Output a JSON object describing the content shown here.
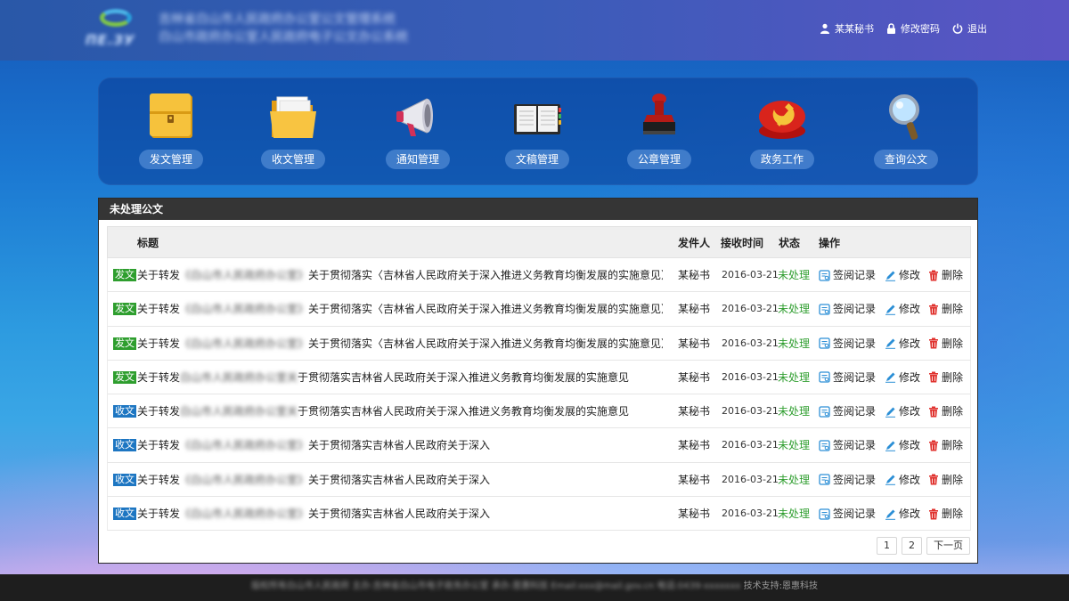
{
  "header": {
    "logo_text": "ПЕ.ЗУ",
    "site_title_line1": "吉林省白山市人民政府办公室公文管理系统",
    "site_title_line2": "白山市政府办公室人民政府电子公文办公系统",
    "links": [
      {
        "label": "某某秘书",
        "icon": "user-icon"
      },
      {
        "label": "修改密码",
        "icon": "lock-icon"
      },
      {
        "label": "退出",
        "icon": "power-icon"
      }
    ]
  },
  "modules": [
    {
      "label": "发文管理",
      "icon": "yellow-folder-icon"
    },
    {
      "label": "收文管理",
      "icon": "open-folder-icon"
    },
    {
      "label": "通知管理",
      "icon": "megaphone-icon"
    },
    {
      "label": "文稿管理",
      "icon": "notebook-icon"
    },
    {
      "label": "公章管理",
      "icon": "stamp-icon"
    },
    {
      "label": "政务工作",
      "icon": "party-emblem-icon"
    },
    {
      "label": "查询公文",
      "icon": "magnifier-icon"
    }
  ],
  "panel": {
    "title": "未处理公文",
    "columns": {
      "title": "标题",
      "sender": "发件人",
      "date": "接收时间",
      "status": "状态",
      "ops": "操作"
    },
    "rows": [
      {
        "tag": "发文",
        "tag_type": "send",
        "prefix": "关于转发",
        "hidden": "《白山市人民政府办公室》",
        "suffix": "关于贯彻落实〈吉林省人民政府关于深入推进义务教育均衡发展的实施意见〉",
        "sender": "某秘书",
        "date": "2016-03-21",
        "status": "未处理"
      },
      {
        "tag": "发文",
        "tag_type": "send",
        "prefix": "关于转发",
        "hidden": "《白山市人民政府办公室》",
        "suffix": "关于贯彻落实〈吉林省人民政府关于深入推进义务教育均衡发展的实施意见〉",
        "sender": "某秘书",
        "date": "2016-03-21",
        "status": "未处理"
      },
      {
        "tag": "发文",
        "tag_type": "send",
        "prefix": "关于转发",
        "hidden": "《白山市人民政府办公室》",
        "suffix": "关于贯彻落实〈吉林省人民政府关于深入推进义务教育均衡发展的实施意见〉",
        "sender": "某秘书",
        "date": "2016-03-21",
        "status": "未处理"
      },
      {
        "tag": "发文",
        "tag_type": "send",
        "prefix": "关于转发",
        "hidden": "白山市人民政府办公室关",
        "suffix": "于贯彻落实吉林省人民政府关于深入推进义务教育均衡发展的实施意见",
        "sender": "某秘书",
        "date": "2016-03-21",
        "status": "未处理"
      },
      {
        "tag": "收文",
        "tag_type": "recv",
        "prefix": "关于转发",
        "hidden": "白山市人民政府办公室关",
        "suffix": "于贯彻落实吉林省人民政府关于深入推进义务教育均衡发展的实施意见",
        "sender": "某秘书",
        "date": "2016-03-21",
        "status": "未处理"
      },
      {
        "tag": "收文",
        "tag_type": "recv",
        "prefix": "关于转发",
        "hidden": "《白山市人民政府办公室》",
        "suffix": "关于贯彻落实吉林省人民政府关于深入",
        "sender": "某秘书",
        "date": "2016-03-21",
        "status": "未处理"
      },
      {
        "tag": "收文",
        "tag_type": "recv",
        "prefix": "关于转发",
        "hidden": "《白山市人民政府办公室》",
        "suffix": "关于贯彻落实吉林省人民政府关于深入",
        "sender": "某秘书",
        "date": "2016-03-21",
        "status": "未处理"
      },
      {
        "tag": "收文",
        "tag_type": "recv",
        "prefix": "关于转发",
        "hidden": "《白山市人民政府办公室》",
        "suffix": "关于贯彻落实吉林省人民政府关于深入",
        "sender": "某秘书",
        "date": "2016-03-21",
        "status": "未处理"
      }
    ],
    "ops": {
      "sign": "签阅记录",
      "edit": "修改",
      "delete": "删除"
    },
    "pager": {
      "pages": [
        "1",
        "2"
      ],
      "next": "下一页"
    }
  },
  "footer": {
    "blurred": "版权所有白山市人民政府 主办:吉林省白山市电子政务办公室 承办:恩惠科技 Email:xxx@mail.gov.cn 电话:0439-xxxxxxx",
    "tech_support": "技术支持:恩惠科技"
  },
  "colors": {
    "header": "#2958a8",
    "panel_head": "#353535",
    "send_tag": "#2e9e2e",
    "recv_tag": "#1d76c2",
    "status": "#2f9e2f"
  }
}
